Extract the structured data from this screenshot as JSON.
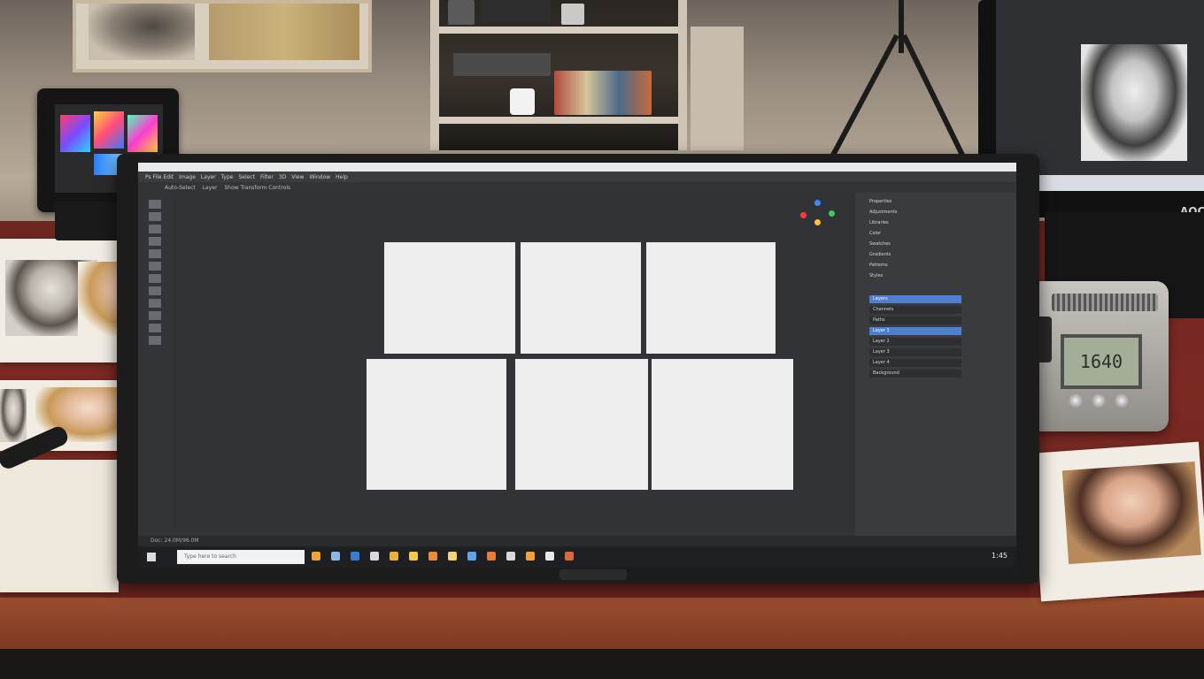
{
  "scene": {
    "device_display": "1640",
    "right_monitor_brand": "AOC"
  },
  "photoshop": {
    "menu_items": [
      "Ps File Edit",
      "Image",
      "Layer",
      "Type",
      "Select",
      "Filter",
      "3D",
      "View",
      "Window",
      "Help"
    ],
    "options_items": [
      "Auto-Select",
      "Layer",
      "Show Transform Controls"
    ],
    "panel_rows": [
      "Properties",
      "Adjustments",
      "Libraries",
      "Color",
      "Swatches",
      "Gradients",
      "Patterns",
      "Styles"
    ],
    "layer_rows": [
      "Layers",
      "Channels",
      "Paths",
      "Layer 1",
      "Layer 2",
      "Layer 3",
      "Layer 4",
      "Background"
    ],
    "status_text": "Doc: 24.0M/96.0M",
    "taskbar": {
      "search_placeholder": "Type here to search",
      "clock": "1:45"
    }
  }
}
